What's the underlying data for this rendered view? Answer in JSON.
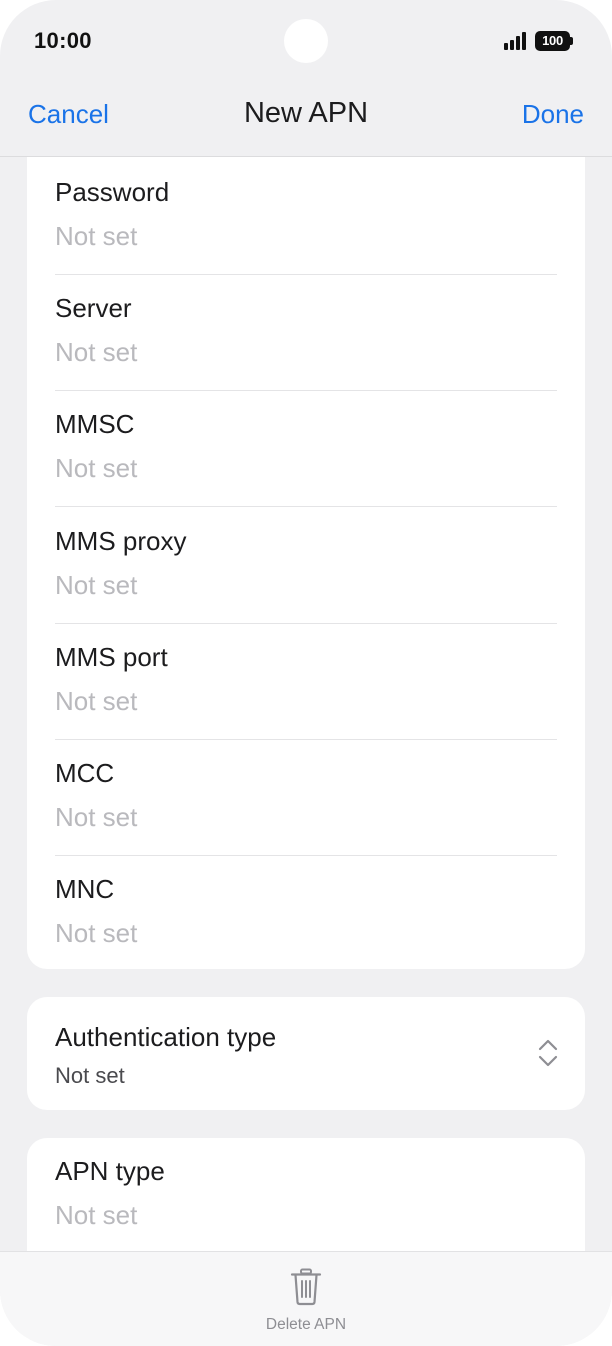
{
  "status_bar": {
    "time": "10:00",
    "battery_level": "100"
  },
  "nav": {
    "cancel_label": "Cancel",
    "title": "New APN",
    "done_label": "Done"
  },
  "fields": [
    {
      "label": "Password",
      "value": "Not set"
    },
    {
      "label": "Server",
      "value": "Not set"
    },
    {
      "label": "MMSC",
      "value": "Not set"
    },
    {
      "label": "MMS proxy",
      "value": "Not set"
    },
    {
      "label": "MMS port",
      "value": "Not set"
    },
    {
      "label": "MCC",
      "value": "Not set"
    },
    {
      "label": "MNC",
      "value": "Not set"
    }
  ],
  "authentication": {
    "label": "Authentication type",
    "value": "Not set"
  },
  "apn_type": {
    "label": "APN type",
    "value": "Not set"
  },
  "bottom_bar": {
    "delete_label": "Delete APN"
  },
  "colors": {
    "accent": "#1a73e8",
    "background": "#f0f0f2",
    "placeholder": "#b9b9bd"
  },
  "icons": [
    "signal-icon",
    "battery-icon",
    "chevron-updown-icon",
    "trash-icon"
  ]
}
